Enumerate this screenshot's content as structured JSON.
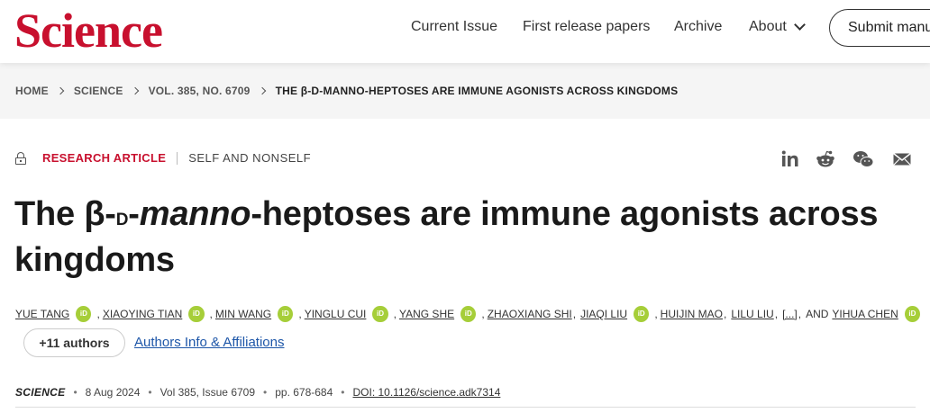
{
  "header": {
    "logo": "Science",
    "nav": [
      "Current Issue",
      "First release papers",
      "Archive",
      "About"
    ],
    "submit_label": "Submit manu"
  },
  "breadcrumb": [
    "HOME",
    "SCIENCE",
    "VOL. 385, NO. 6709",
    "THE β-D-MANNO-HEPTOSES ARE IMMUNE AGONISTS ACROSS KINGDOMS"
  ],
  "article": {
    "type": "RESEARCH ARTICLE",
    "section": "SELF AND NONSELF",
    "title_parts": {
      "p1": "The β-",
      "p2": "d",
      "p3": "-",
      "p4": "manno",
      "p5": "-heptoses are immune agonists across",
      "p6": "kingdoms"
    },
    "authors": [
      "YUE TANG",
      "XIAOYING TIAN",
      "MIN WANG",
      "YINGLU CUI",
      "YANG SHE",
      "ZHAOXIANG SHI",
      "JIAQI LIU",
      "HUIJIN MAO",
      "LILU LIU",
      "[...]",
      "AND",
      "YIHUA CHEN"
    ],
    "orcid_label": "iD",
    "more_authors": "+11 authors",
    "affiliations_link": "Authors Info & Affiliations",
    "journal": "SCIENCE",
    "date": "8 Aug 2024",
    "volume": "Vol 385, Issue 6709",
    "pages": "pp. 678-684",
    "doi": "DOI: 10.1126/science.adk7314"
  },
  "share_icons": [
    "linkedin-icon",
    "reddit-icon",
    "wechat-icon",
    "email-icon"
  ],
  "colors": {
    "brand": "#c8102e",
    "link": "#1d56a8",
    "orcid": "#a6ce39"
  }
}
